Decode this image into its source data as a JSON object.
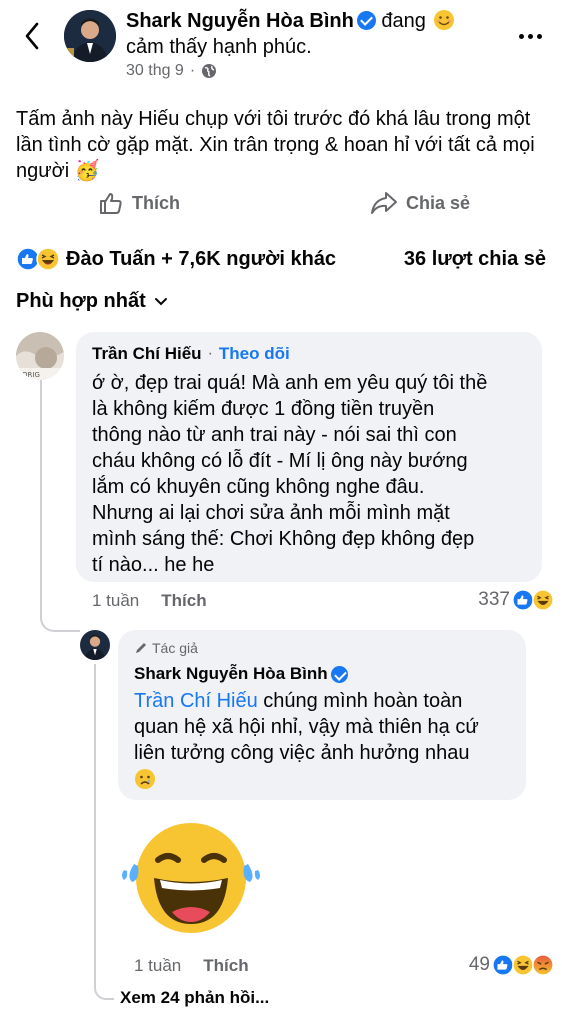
{
  "post": {
    "author_name": "Shark Nguyễn Hòa Bình",
    "feeling_prefix": "đang",
    "feeling_text": "cảm thấy hạnh phúc.",
    "timestamp": "30 thg 9",
    "separator": "·",
    "body": "Tấm ảnh này Hiếu chụp với tôi trước đó khá lâu trong một lần tình cờ gặp mặt. Xin trân trọng & hoan hỉ với tất cả mọi người 🥳",
    "like_label": "Thích",
    "share_label": "Chia sẻ",
    "reactions_text": "Đào Tuấn + 7,6K người khác",
    "shares_text": "36 lượt chia sẻ"
  },
  "sort": {
    "label": "Phù hợp nhất"
  },
  "comments": [
    {
      "name": "Trần Chí Hiếu",
      "separator": "·",
      "follow_label": "Theo dõi",
      "text_lines": [
        "ớ ờ, đẹp trai quá! Mà anh em yêu quý tôi thề",
        "là không kiếm được 1 đồng tiền truyền",
        "thông nào từ anh trai này - nói sai thì con",
        "cháu không có lỗ đít - Mí lị ông này bướng",
        "lắm có khuyên cũng không nghe đâu.",
        "Nhưng ai lại chơi sửa ảnh mỗi mình mặt",
        "mình sáng thế: Chơi Không đẹp không đẹp",
        "tí nào... he he"
      ],
      "time": "1 tuần",
      "like_label": "Thích",
      "reaction_count": "337"
    },
    {
      "author_tag": "Tác giả",
      "name": "Shark Nguyễn Hòa Bình",
      "mention": "Trần Chí Hiếu",
      "text_line1_rest": " chúng mình hoàn toàn",
      "text_line2": "quan hệ xã hội nhỉ, vậy mà thiên hạ cứ",
      "text_line3": "liên tưởng công việc ảnh hưởng nhau",
      "time": "1 tuần",
      "like_label": "Thích",
      "reaction_count": "49"
    }
  ],
  "view_more": "Xem 24 phản hồi...",
  "colors": {
    "accent": "#1877f2",
    "secondary_text": "#65676b",
    "bubble": "#f0f2f5",
    "haha": "#f7c531",
    "angry": "#e9573f"
  }
}
